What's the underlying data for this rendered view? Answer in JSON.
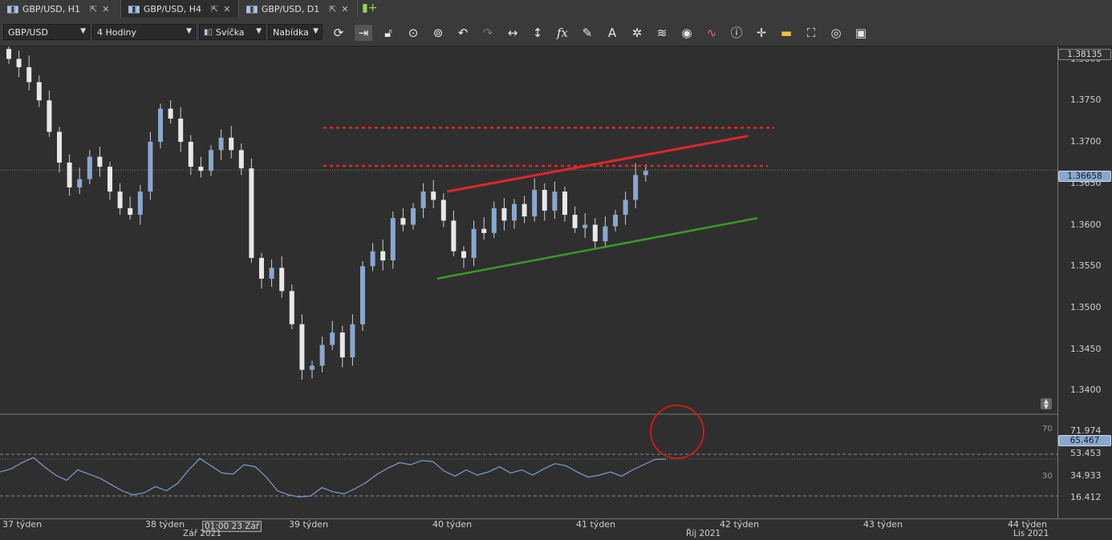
{
  "tabs": [
    {
      "label": "GBP/USD, H1",
      "active": false
    },
    {
      "label": "GBP/USD, H4",
      "active": true
    },
    {
      "label": "GBP/USD, D1",
      "active": false
    }
  ],
  "toolbar": {
    "symbol": "GBP/USD",
    "timeframe": "4 Hodiny",
    "chart_type": "Svíčka",
    "quote_side": "Nabídka",
    "tools": [
      "refresh-icon",
      "autoscroll-icon",
      "lock-icon",
      "zoom-icon",
      "zoom-fit-icon",
      "undo-icon",
      "redo-icon",
      "horizontal-resize-icon",
      "vertical-resize-icon",
      "fx-icon",
      "pencil-icon",
      "text-icon",
      "crosshair-icon",
      "layers-icon",
      "eye-icon",
      "indicator-icon",
      "info-icon",
      "cursor-icon",
      "palette-icon",
      "fill-icon",
      "settings-circle-icon",
      "save-icon"
    ]
  },
  "price_axis": {
    "labels": [
      "1.3800",
      "1.3750",
      "1.3700",
      "1.3650",
      "1.3600",
      "1.3550",
      "1.3500",
      "1.3450",
      "1.3400"
    ],
    "top_tag": "1.38135",
    "current_tag": "1.36658"
  },
  "rsi": {
    "level_high": "70",
    "level_low": "30",
    "axis_labels": [
      "71.974",
      "53.453",
      "34.933",
      "16.412"
    ],
    "current_tag": "65.467"
  },
  "time_axis": {
    "weeks": [
      "37 týden",
      "38 týden",
      "39 týden",
      "40 týden",
      "41 týden",
      "42 týden",
      "43 týden",
      "44 týden"
    ],
    "months": [
      "Zář 2021",
      "Říj 2021",
      "Lis 2021"
    ],
    "crosshair_label": "01:00 23 Zář"
  },
  "colors": {
    "bull": "#8aa7cf",
    "bear": "#e8e8e8",
    "resistance": "#e0262a",
    "support": "#3a9a2a",
    "rsi_line": "#7f9ed0",
    "highlight_circle": "#cc1a1a"
  },
  "chart_data": {
    "type": "candlestick",
    "symbol": "GBP/USD",
    "timeframe": "H4",
    "ylim": [
      1.3385,
      1.3815
    ],
    "price_drift_overall": [
      1.3815,
      1.366
    ],
    "trendlines": {
      "dotted_resistance_levels": [
        1.3717,
        1.3671
      ],
      "rising_resistance": {
        "from": 1.364,
        "to": 1.3707
      },
      "rising_support": {
        "from": 1.3535,
        "to": 1.3608
      }
    },
    "close_path": [
      1.38,
      1.379,
      1.3772,
      1.375,
      1.3712,
      1.3675,
      1.3645,
      1.3655,
      1.3682,
      1.367,
      1.364,
      1.362,
      1.3612,
      1.364,
      1.37,
      1.374,
      1.3728,
      1.37,
      1.367,
      1.3665,
      1.369,
      1.3705,
      1.369,
      1.3668,
      1.356,
      1.3535,
      1.3548,
      1.352,
      1.348,
      1.3425,
      1.343,
      1.3455,
      1.347,
      1.344,
      1.348,
      1.355,
      1.3568,
      1.3557,
      1.3608,
      1.36,
      1.362,
      1.364,
      1.363,
      1.3605,
      1.3568,
      1.356,
      1.3595,
      1.359,
      1.362,
      1.3605,
      1.3625,
      1.361,
      1.3642,
      1.3617,
      1.364,
      1.3612,
      1.3596,
      1.36,
      1.358,
      1.3598,
      1.3612,
      1.363,
      1.366,
      1.3665
    ],
    "rsi_values": [
      53,
      56,
      62,
      67,
      58,
      50,
      45,
      55,
      51,
      47,
      41,
      35,
      31,
      33,
      39,
      35,
      42,
      55,
      66,
      59,
      52,
      51,
      60,
      58,
      48,
      35,
      31,
      29,
      30,
      38,
      34,
      32,
      37,
      43,
      51,
      57,
      62,
      60,
      64,
      63,
      54,
      49,
      55,
      50,
      53,
      58,
      52,
      55,
      50,
      56,
      61,
      59,
      53,
      48,
      50,
      53,
      49,
      55,
      60,
      65,
      65.467
    ]
  }
}
